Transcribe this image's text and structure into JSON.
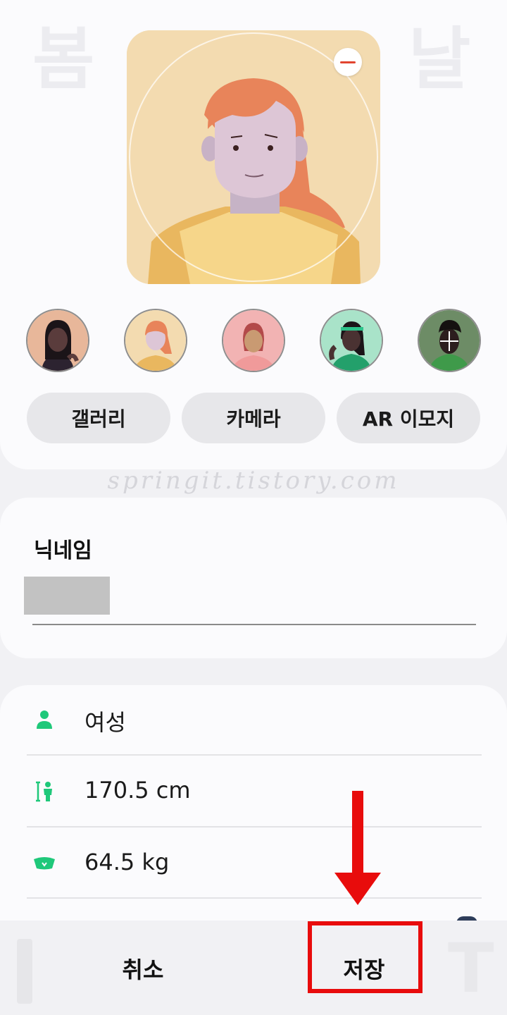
{
  "header": {
    "bg_letter_left": "봄",
    "bg_letter_right": "날"
  },
  "avatar": {
    "selected": "orange-hair-woman",
    "remove_icon": "minus-circle-icon",
    "thumbnails": [
      {
        "name": "avatar-dark-hair-woman",
        "bg": "#e8b79a"
      },
      {
        "name": "avatar-orange-hair-woman",
        "bg": "#f3dbb0"
      },
      {
        "name": "avatar-red-hair-woman",
        "bg": "#f2b3b3"
      },
      {
        "name": "avatar-headband-woman",
        "bg": "#a9e3c9"
      },
      {
        "name": "avatar-dreadlock-man",
        "bg": "#6d8c66"
      }
    ]
  },
  "buttons": {
    "gallery": "갤러리",
    "camera": "카메라",
    "ar_emoji": "AR 이모지"
  },
  "watermark": "springit.tistory.com",
  "nickname": {
    "label": "닉네임"
  },
  "profile": {
    "gender": "여성",
    "height": "170.5 cm",
    "weight": "64.5 kg",
    "icons": [
      "person-icon",
      "height-icon",
      "weight-scale-icon"
    ],
    "icon_color": "#1fc87a"
  },
  "bottom": {
    "cancel": "취소",
    "save": "저장",
    "ghost_right": "T"
  },
  "annotation": {
    "color": "#e80c0c"
  }
}
